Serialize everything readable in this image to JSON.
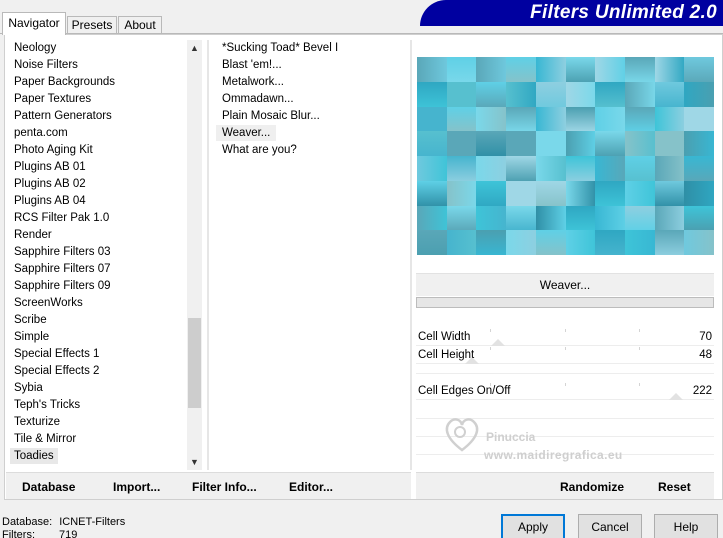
{
  "tabs": [
    "Navigator",
    "Presets",
    "About"
  ],
  "app_title": "Filters Unlimited 2.0",
  "categories": [
    "Neology",
    "Noise Filters",
    "Paper Backgrounds",
    "Paper Textures",
    "Pattern Generators",
    "penta.com",
    "Photo Aging Kit",
    "Plugins AB 01",
    "Plugins AB 02",
    "Plugins AB 04",
    "RCS Filter Pak 1.0",
    "Render",
    "Sapphire Filters 03",
    "Sapphire Filters 07",
    "Sapphire Filters 09",
    "ScreenWorks",
    "Scribe",
    "Simple",
    "Special Effects 1",
    "Special Effects 2",
    "Sybia",
    "Teph's Tricks",
    "Texturize",
    "Tile & Mirror",
    "Toadies"
  ],
  "selected_category": "Toadies",
  "filters": [
    "*Sucking Toad*  Bevel I",
    "Blast 'em!...",
    "Metalwork...",
    "Ommadawn...",
    "Plain Mosaic Blur...",
    "Weaver...",
    "What are you?"
  ],
  "selected_filter": "Weaver...",
  "current_filter_label": "Weaver...",
  "sliders": [
    {
      "label": "Cell Width",
      "value": "70",
      "fraction": 0.275
    },
    {
      "label": "Cell Height",
      "value": "48",
      "fraction": 0.188
    },
    {
      "label": "Cell Edges On/Off",
      "value": "222",
      "fraction": 0.871
    }
  ],
  "watermark": {
    "line1": "Pinuccia",
    "line2": "www.maidiregrafica.eu"
  },
  "bottom_left_buttons": [
    "Database",
    "Import...",
    "Filter Info...",
    "Editor..."
  ],
  "bottom_right_buttons": [
    "Randomize",
    "Reset"
  ],
  "footer": {
    "database_label": "Database:",
    "database_value": "ICNET-Filters",
    "filters_label": "Filters:",
    "filters_value": "719"
  },
  "dialog_buttons": {
    "apply": "Apply",
    "cancel": "Cancel",
    "help": "Help"
  },
  "colors": {
    "banner": "#0000a0",
    "accent": "#0078d7",
    "preview_base": "#4ec6dc"
  },
  "icons": {
    "scroll_up": "chevron-up-icon",
    "scroll_down": "chevron-down-icon",
    "watermark": "heart-logo-icon"
  }
}
